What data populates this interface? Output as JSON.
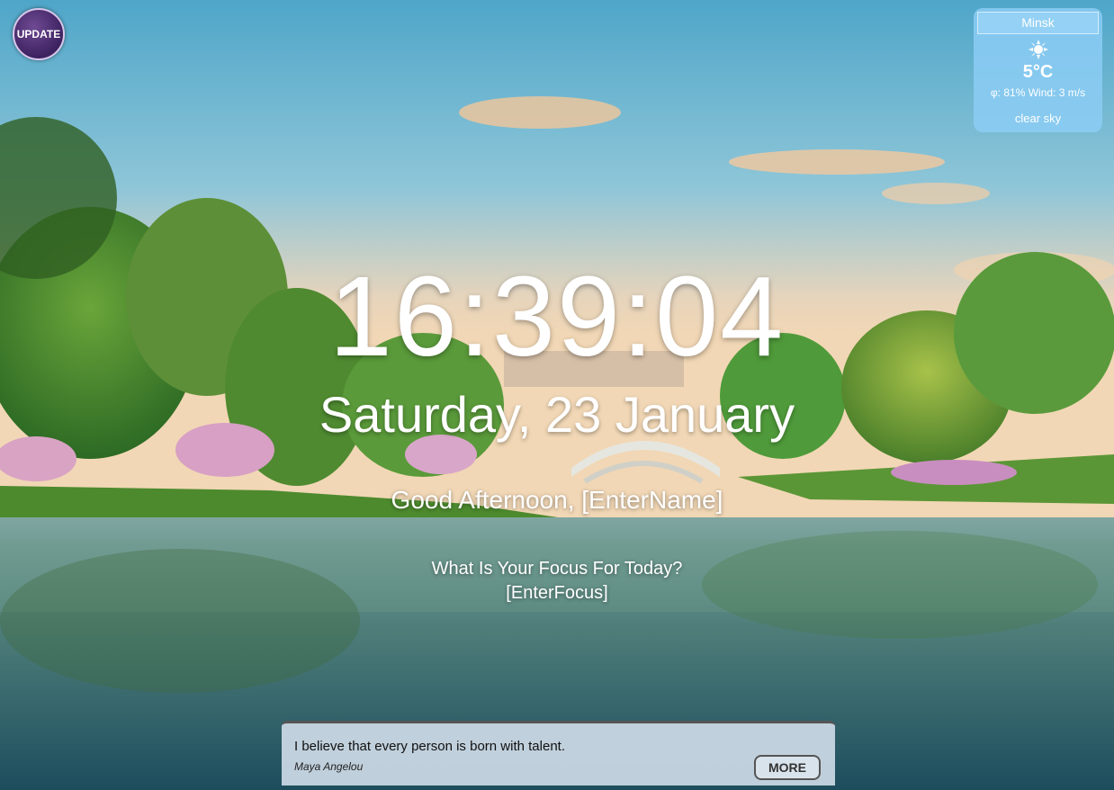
{
  "update_button": {
    "label": "UPDATE",
    "icon": "circle-button"
  },
  "weather": {
    "city": "Minsk",
    "icon": "sun-icon",
    "temperature": "5°C",
    "humidity_label": "φ:",
    "humidity": "81%",
    "wind_label": "Wind:",
    "wind": "3 m/s",
    "description": "clear sky"
  },
  "clock": {
    "time": "16:39:04"
  },
  "date": {
    "text": "Saturday, 23 January"
  },
  "greeting": {
    "prefix": "Good Afternoon,",
    "name": "[EnterName]"
  },
  "focus": {
    "question": "What Is Your Focus For Today?",
    "value": "[EnterFocus]"
  },
  "quote": {
    "text": "I believe that every person is born with talent.",
    "author": "Maya Angelou",
    "more_label": "MORE"
  }
}
